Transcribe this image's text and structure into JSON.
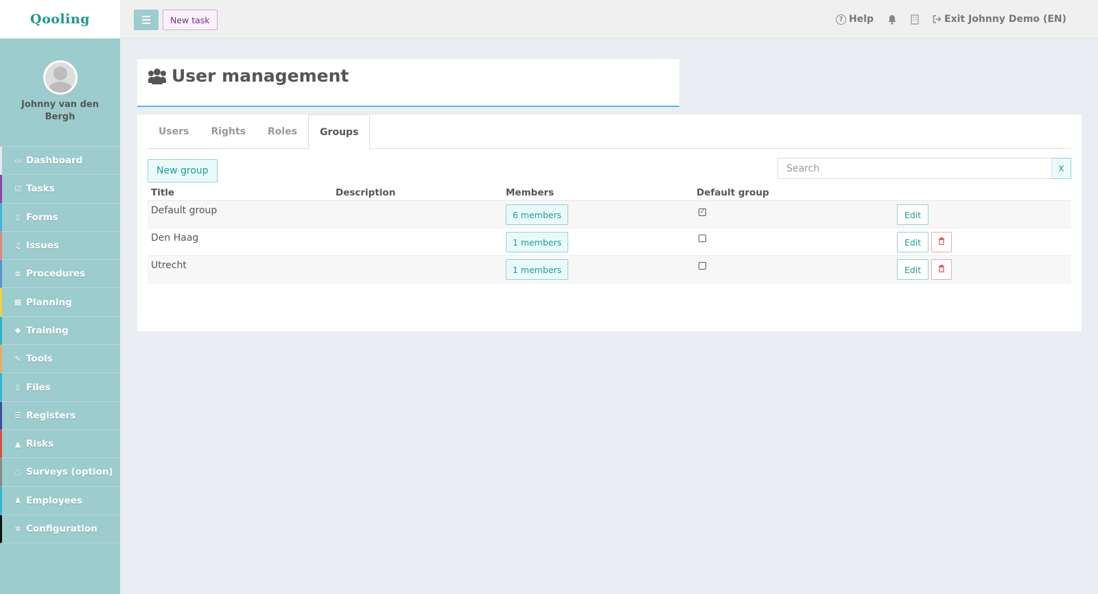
{
  "logo": {
    "text": "Qooling"
  },
  "profile": {
    "name": "Johnny van den Bergh"
  },
  "nav": {
    "items": [
      {
        "label": "Dashboard",
        "icon": "monitor-icon",
        "glyph": "▭",
        "color": "#e8e8e8"
      },
      {
        "label": "Tasks",
        "icon": "check-square-icon",
        "glyph": "☑",
        "color": "#8e44ad"
      },
      {
        "label": "Forms",
        "icon": "file-icon",
        "glyph": "▯",
        "color": "#3fb6d8"
      },
      {
        "label": "Issues",
        "icon": "bell-icon",
        "glyph": "♫",
        "color": "#e8817a"
      },
      {
        "label": "Procedures",
        "icon": "list-icon",
        "glyph": "≡",
        "color": "#5b8fd6"
      },
      {
        "label": "Planning",
        "icon": "calendar-icon",
        "glyph": "▦",
        "color": "#f0d23c"
      },
      {
        "label": "Training",
        "icon": "graduation-cap-icon",
        "glyph": "◆",
        "color": "#2fb0c9"
      },
      {
        "label": "Tools",
        "icon": "wrench-icon",
        "glyph": "✎",
        "color": "#f0a860"
      },
      {
        "label": "Files",
        "icon": "file-pdf-icon",
        "glyph": "▯",
        "color": "#2fb6d8"
      },
      {
        "label": "Registers",
        "icon": "list-lines-icon",
        "glyph": "☰",
        "color": "#3b4fa6"
      },
      {
        "label": "Risks",
        "icon": "warning-icon",
        "glyph": "▲",
        "color": "#e04a3e"
      },
      {
        "label": "Surveys (option)",
        "icon": "comments-icon",
        "glyph": "◌",
        "color": "#888888"
      },
      {
        "label": "Employees",
        "icon": "users-icon",
        "glyph": "♟",
        "color": "#2fb6d8"
      },
      {
        "label": "Configuration",
        "icon": "gear-icon",
        "glyph": "✲",
        "color": "#111111"
      }
    ]
  },
  "topbar": {
    "new_task_label": "New task",
    "help_label": "Help",
    "exit_label": "Exit Johnny Demo (EN)"
  },
  "page": {
    "title": "User management"
  },
  "tabs": [
    "Users",
    "Rights",
    "Roles",
    "Groups"
  ],
  "active_tab": "Groups",
  "toolbar": {
    "new_group_label": "New group",
    "search_placeholder": "Search",
    "clear_label": "X"
  },
  "table": {
    "headers": {
      "title": "Title",
      "description": "Description",
      "members": "Members",
      "default_group": "Default group"
    },
    "rows": [
      {
        "title": "Default group",
        "description": "",
        "members": "6 members",
        "default": true,
        "edit": "Edit",
        "deletable": false
      },
      {
        "title": "Den Haag",
        "description": "",
        "members": "1 members",
        "default": false,
        "edit": "Edit",
        "deletable": true
      },
      {
        "title": "Utrecht",
        "description": "",
        "members": "1 members",
        "default": false,
        "edit": "Edit",
        "deletable": true
      }
    ]
  }
}
